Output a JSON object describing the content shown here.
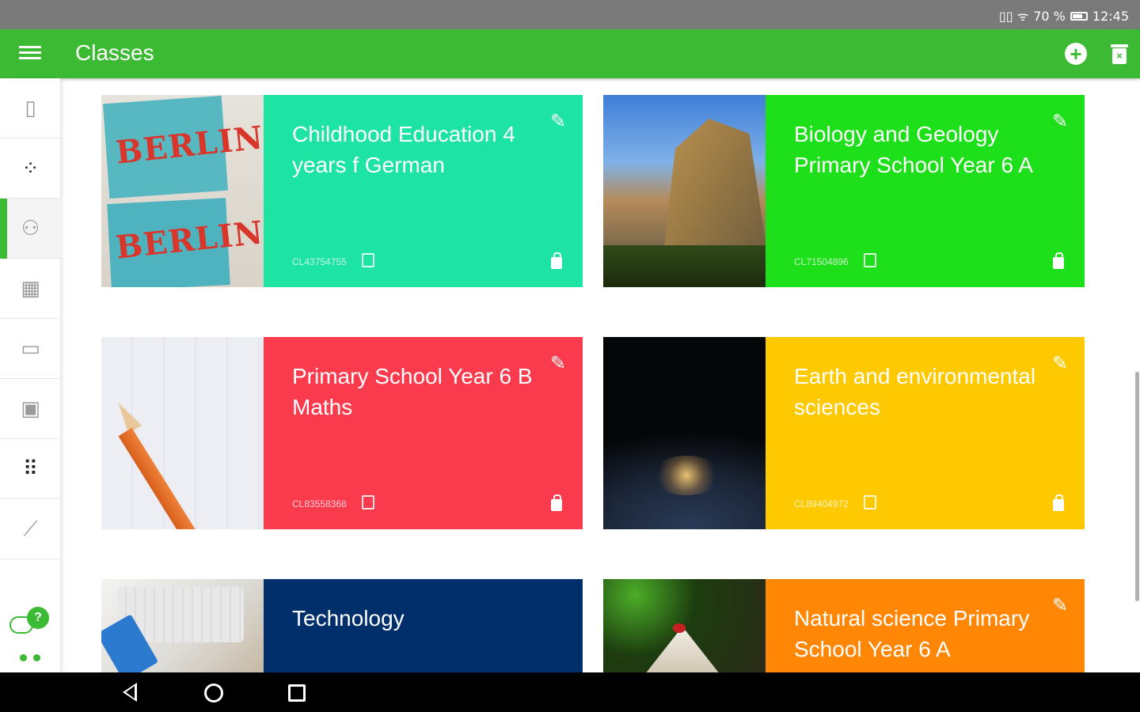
{
  "status_bar": {
    "indicators": "▯▯ ᯤ",
    "battery": "70 %",
    "time": "12:45"
  },
  "app_bar": {
    "title": "Classes",
    "icons": [
      "menu-icon",
      "add-circle-icon",
      "trash-icon"
    ]
  },
  "sidebar": {
    "items": [
      {
        "name": "sidebar-item-notebook",
        "icon": "notebook-icon",
        "glyph": "▯"
      },
      {
        "name": "sidebar-item-grid",
        "icon": "dot-grid-icon",
        "glyph": "⁘"
      },
      {
        "name": "sidebar-item-classes",
        "icon": "users-icon",
        "glyph": "⚇",
        "active": true
      },
      {
        "name": "sidebar-item-calendar-grid",
        "icon": "calendar-grid-icon",
        "glyph": "▦"
      },
      {
        "name": "sidebar-item-messages",
        "icon": "chat-icon",
        "glyph": "▭"
      },
      {
        "name": "sidebar-item-schedule",
        "icon": "calendar-icon",
        "glyph": "▣"
      },
      {
        "name": "sidebar-item-apps",
        "icon": "apps-icon",
        "glyph": "⠿"
      },
      {
        "name": "sidebar-item-stats",
        "icon": "trend-icon",
        "glyph": "⟋"
      }
    ],
    "help_badge": "?"
  },
  "classes": [
    {
      "title": "Childhood Education 4 years f German",
      "code": "CL43754755",
      "color": "#1de4a2",
      "thumb": "berlin",
      "thumb_text": "BERLIN"
    },
    {
      "title": "Biology and Geology Primary School Year 6 A",
      "code": "CL71504896",
      "color": "#1ee01a",
      "thumb": "mountain"
    },
    {
      "title": "Primary School Year 6 B Maths",
      "code": "CL83558368",
      "color": "#fa3a4d",
      "thumb": "math"
    },
    {
      "title": "Earth and environmental sciences",
      "code": "CL89404972",
      "color": "#ffc900",
      "thumb": "earth"
    },
    {
      "title": "Technology",
      "code": "",
      "color": "#002f6b",
      "thumb": "tech"
    },
    {
      "title": "Natural science Primary School Year 6 A",
      "code": "",
      "color": "#ff8705",
      "thumb": "nature"
    }
  ],
  "nav_bar": {
    "icons": [
      "back-icon",
      "home-icon",
      "recent-apps-icon"
    ]
  }
}
